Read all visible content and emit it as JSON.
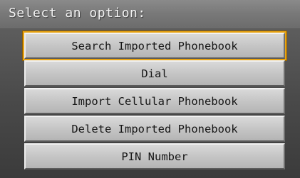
{
  "header": {
    "title": "Select an option:"
  },
  "menu": {
    "selected_index": 0,
    "items": [
      {
        "label": "Search Imported Phonebook"
      },
      {
        "label": "Dial"
      },
      {
        "label": "Import Cellular Phonebook"
      },
      {
        "label": "Delete Imported Phonebook"
      },
      {
        "label": "PIN Number"
      }
    ]
  },
  "colors": {
    "highlight": "#e8a311",
    "button_face": "#c9c9c9",
    "background": "#4a4a4a"
  }
}
